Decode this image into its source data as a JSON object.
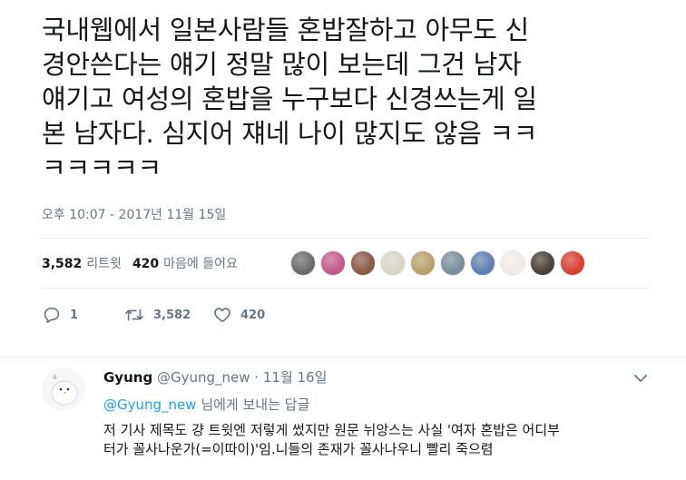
{
  "tweet": {
    "text": "국내웹에서 일본사람들 혼밥잘하고 아무도 신\n경안쓴다는 얘기 정말 많이 보는데 그건 남자\n얘기고 여성의 혼밥을 누구보다 신경쓰는게 일\n본 남자다. 심지어 쟤네 나이 많지도 않음 ㅋㅋ\nㅋㅋㅋㅋㅋ",
    "timestamp": "오후 10:07 - 2017년 11월 15일"
  },
  "stats": {
    "retweets_count": "3,582",
    "retweets_label": "리트윗",
    "likes_count": "420",
    "likes_label": "마음에 들어요"
  },
  "liker_avatars": [
    {
      "name": "avatar-1",
      "color": "#6b6b6b"
    },
    {
      "name": "avatar-2",
      "color": "#c25b8c"
    },
    {
      "name": "avatar-3",
      "color": "#8a5a44"
    },
    {
      "name": "avatar-4",
      "color": "#d9d4c8"
    },
    {
      "name": "avatar-5",
      "color": "#b8a06a"
    },
    {
      "name": "avatar-6",
      "color": "#7a8c9a"
    },
    {
      "name": "avatar-7",
      "color": "#5f7fb0"
    },
    {
      "name": "avatar-8",
      "color": "#efeae4"
    },
    {
      "name": "avatar-9",
      "color": "#4a4036"
    },
    {
      "name": "avatar-10",
      "color": "#d6402f"
    }
  ],
  "actions": {
    "reply_count": "1",
    "retweet_count": "3,582",
    "like_count": "420"
  },
  "reply": {
    "name": "Gyung",
    "handle": "@Gyung_new",
    "separator": "·",
    "date": "11월 16일",
    "reply_to_mention": "@Gyung_new",
    "reply_to_suffix": " 님에게 보내는 답글",
    "text": "저 기사 제목도 걍 트윗엔 저렇게 썼지만 원문 뉘앙스는 사실 '여자 혼밥은 어디부\n터가 꼴사나운가(=이따이)'임.니들의 존재가 꼴사나우니 빨리 죽으렴"
  },
  "colors": {
    "text": "#14171a",
    "muted": "#657786",
    "link": "#1da1f2",
    "divider": "#e6ecf0"
  },
  "icons": [
    "reply-icon",
    "retweet-icon",
    "heart-icon",
    "chevron-down-icon"
  ]
}
